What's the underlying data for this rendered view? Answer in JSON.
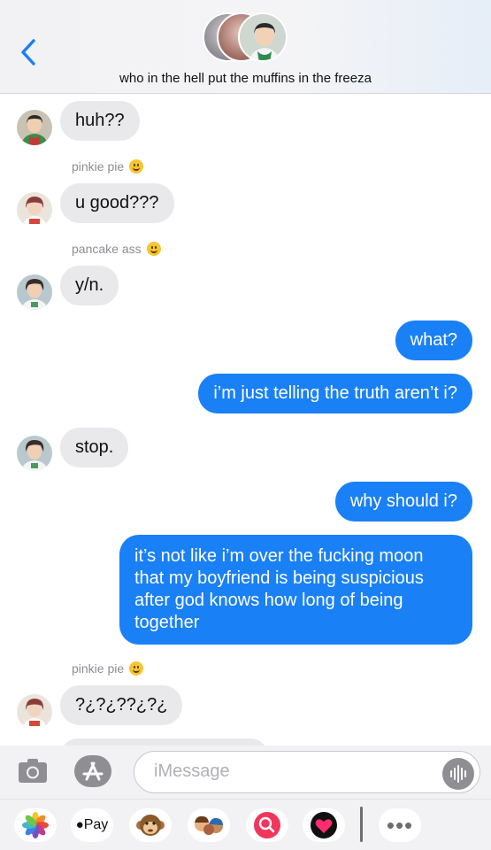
{
  "header": {
    "back_icon": "chevron-left-icon",
    "group_title": "who in the hell put the muffins in the freeza"
  },
  "messages": [
    {
      "direction": "in",
      "text": "huh??"
    },
    {
      "direction": "in",
      "sender": "pinkie pie",
      "sender_emoji": "grinning-face",
      "text": "u good???"
    },
    {
      "direction": "in",
      "sender": "pancake ass",
      "sender_emoji": "kissing-face",
      "text": "y/n."
    },
    {
      "direction": "out",
      "text": "what?"
    },
    {
      "direction": "out",
      "text": "i’m just telling the truth aren’t i?"
    },
    {
      "direction": "in",
      "text": "stop."
    },
    {
      "direction": "out",
      "text": "why should i?"
    },
    {
      "direction": "out",
      "text": "it’s not like i’m over the fucking moon that my boyfriend is being suspicious after god knows how long of being together"
    },
    {
      "direction": "in",
      "sender": "pinkie pie",
      "sender_emoji": "grinning-face",
      "text": "?¿?¿??¿?¿"
    }
  ],
  "compose": {
    "placeholder": "iMessage",
    "camera_icon": "camera-icon",
    "appstore_icon": "app-store-icon",
    "audio_icon": "audio-waveform-icon"
  },
  "app_drawer": {
    "apple_pay_label": "Pay",
    "apps": [
      "photos-icon",
      "apple-pay-icon",
      "monkey-memoji-icon",
      "memoji-icon",
      "search-images-icon",
      "digital-touch-icon",
      "more-icon"
    ]
  },
  "colors": {
    "accent": "#1a80f6",
    "incoming_bubble": "#e9e9eb",
    "outgoing_text": "#ffffff"
  }
}
